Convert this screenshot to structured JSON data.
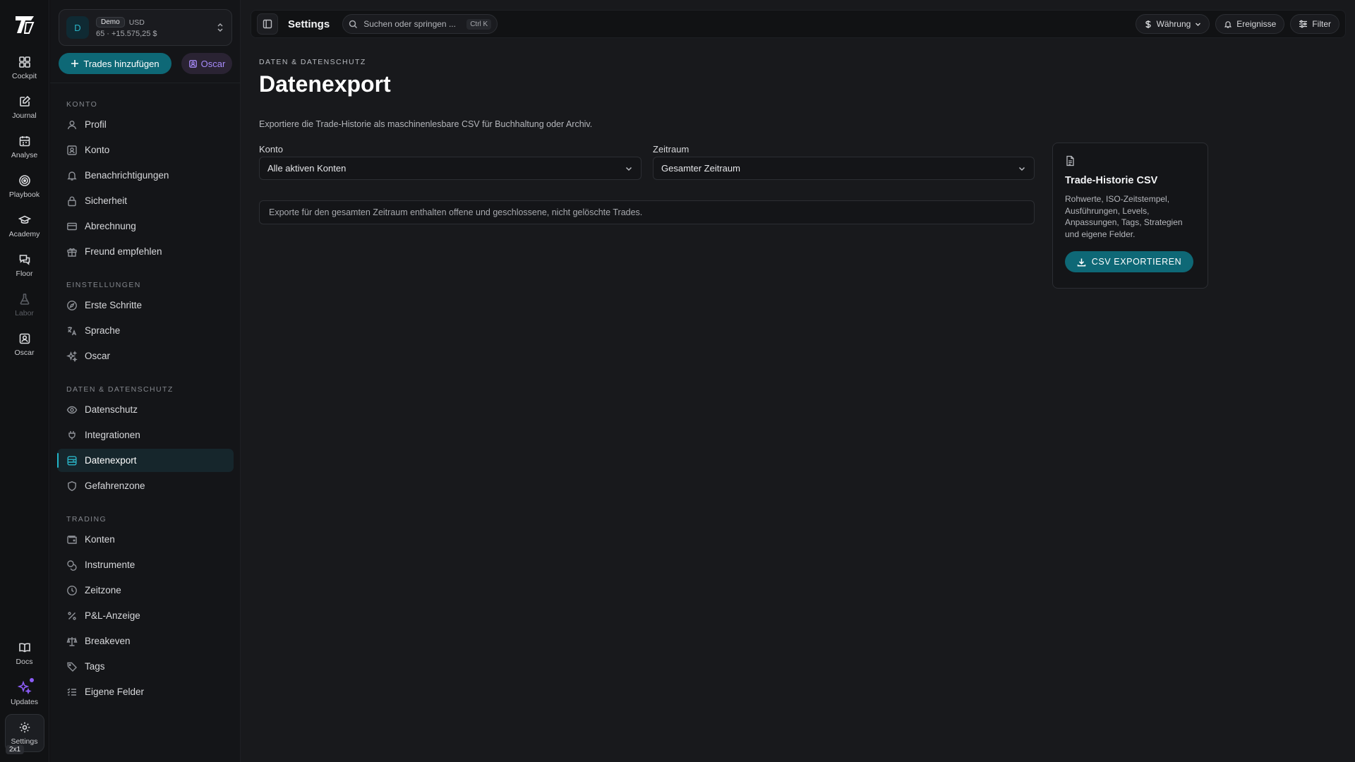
{
  "rail": {
    "items": [
      {
        "label": "Cockpit",
        "icon": "grid-icon"
      },
      {
        "label": "Journal",
        "icon": "edit-note-icon"
      },
      {
        "label": "Analyse",
        "icon": "calendar-icon"
      },
      {
        "label": "Playbook",
        "icon": "target-icon"
      },
      {
        "label": "Academy",
        "icon": "graduation-cap-icon"
      },
      {
        "label": "Floor",
        "icon": "chat-icon"
      },
      {
        "label": "Labor",
        "icon": "flask-icon"
      },
      {
        "label": "Oscar",
        "icon": "contact-icon"
      }
    ],
    "bottom": [
      {
        "label": "Docs",
        "icon": "book-icon"
      },
      {
        "label": "Updates",
        "icon": "sparkles-icon"
      },
      {
        "label": "Settings",
        "icon": "gear-icon"
      }
    ],
    "zoom_badge": "2x1"
  },
  "account": {
    "avatar": "D",
    "mode": "Demo",
    "currency": "USD",
    "summary": "65 · +15.575,25 $"
  },
  "actions": {
    "add_trades": "Trades hinzufügen",
    "oscar": "Oscar"
  },
  "nav": {
    "sections": [
      {
        "heading": "KONTO",
        "items": [
          {
            "label": "Profil",
            "icon": "user-icon"
          },
          {
            "label": "Konto",
            "icon": "id-card-icon"
          },
          {
            "label": "Benachrichtigungen",
            "icon": "bell-icon"
          },
          {
            "label": "Sicherheit",
            "icon": "lock-icon"
          },
          {
            "label": "Abrechnung",
            "icon": "credit-card-icon"
          },
          {
            "label": "Freund empfehlen",
            "icon": "gift-icon"
          }
        ]
      },
      {
        "heading": "EINSTELLUNGEN",
        "items": [
          {
            "label": "Erste Schritte",
            "icon": "compass-icon"
          },
          {
            "label": "Sprache",
            "icon": "translate-icon"
          },
          {
            "label": "Oscar",
            "icon": "sparkle-icon"
          }
        ]
      },
      {
        "heading": "DATEN & DATENSCHUTZ",
        "items": [
          {
            "label": "Datenschutz",
            "icon": "eye-icon"
          },
          {
            "label": "Integrationen",
            "icon": "plug-icon"
          },
          {
            "label": "Datenexport",
            "icon": "database-icon",
            "active": true
          },
          {
            "label": "Gefahrenzone",
            "icon": "shield-icon"
          }
        ]
      },
      {
        "heading": "TRADING",
        "items": [
          {
            "label": "Konten",
            "icon": "wallet-icon"
          },
          {
            "label": "Instrumente",
            "icon": "coins-icon"
          },
          {
            "label": "Zeitzone",
            "icon": "clock-icon"
          },
          {
            "label": "P&L-Anzeige",
            "icon": "percent-icon"
          },
          {
            "label": "Breakeven",
            "icon": "scale-icon"
          },
          {
            "label": "Tags",
            "icon": "tag-icon"
          },
          {
            "label": "Eigene Felder",
            "icon": "list-check-icon"
          }
        ]
      }
    ]
  },
  "topbar": {
    "title": "Settings",
    "search_placeholder": "Suchen oder springen ...",
    "search_shortcut": "Ctrl K",
    "currency": "Währung",
    "events": "Ereignisse",
    "filter": "Filter"
  },
  "page": {
    "breadcrumb": "DATEN & DATENSCHUTZ",
    "title": "Datenexport",
    "description": "Exportiere die Trade-Historie als maschinenlesbare CSV für Buchhaltung oder Archiv.",
    "account_label": "Konto",
    "account_value": "Alle aktiven Konten",
    "period_label": "Zeitraum",
    "period_value": "Gesamter Zeitraum",
    "notice": "Exporte für den gesamten Zeitraum enthalten offene und geschlossene, nicht gelöschte Trades.",
    "card": {
      "title": "Trade-Historie CSV",
      "description": "Rohwerte, ISO-Zeitstempel, Ausführungen, Levels, Anpassungen, Tags, Strategien und eigene Felder.",
      "button": "CSV EXPORTIEREN"
    }
  },
  "colors": {
    "accent": "#0e6876",
    "accent_bright": "#22b4c8",
    "oscar_purple": "#a78bfa"
  }
}
